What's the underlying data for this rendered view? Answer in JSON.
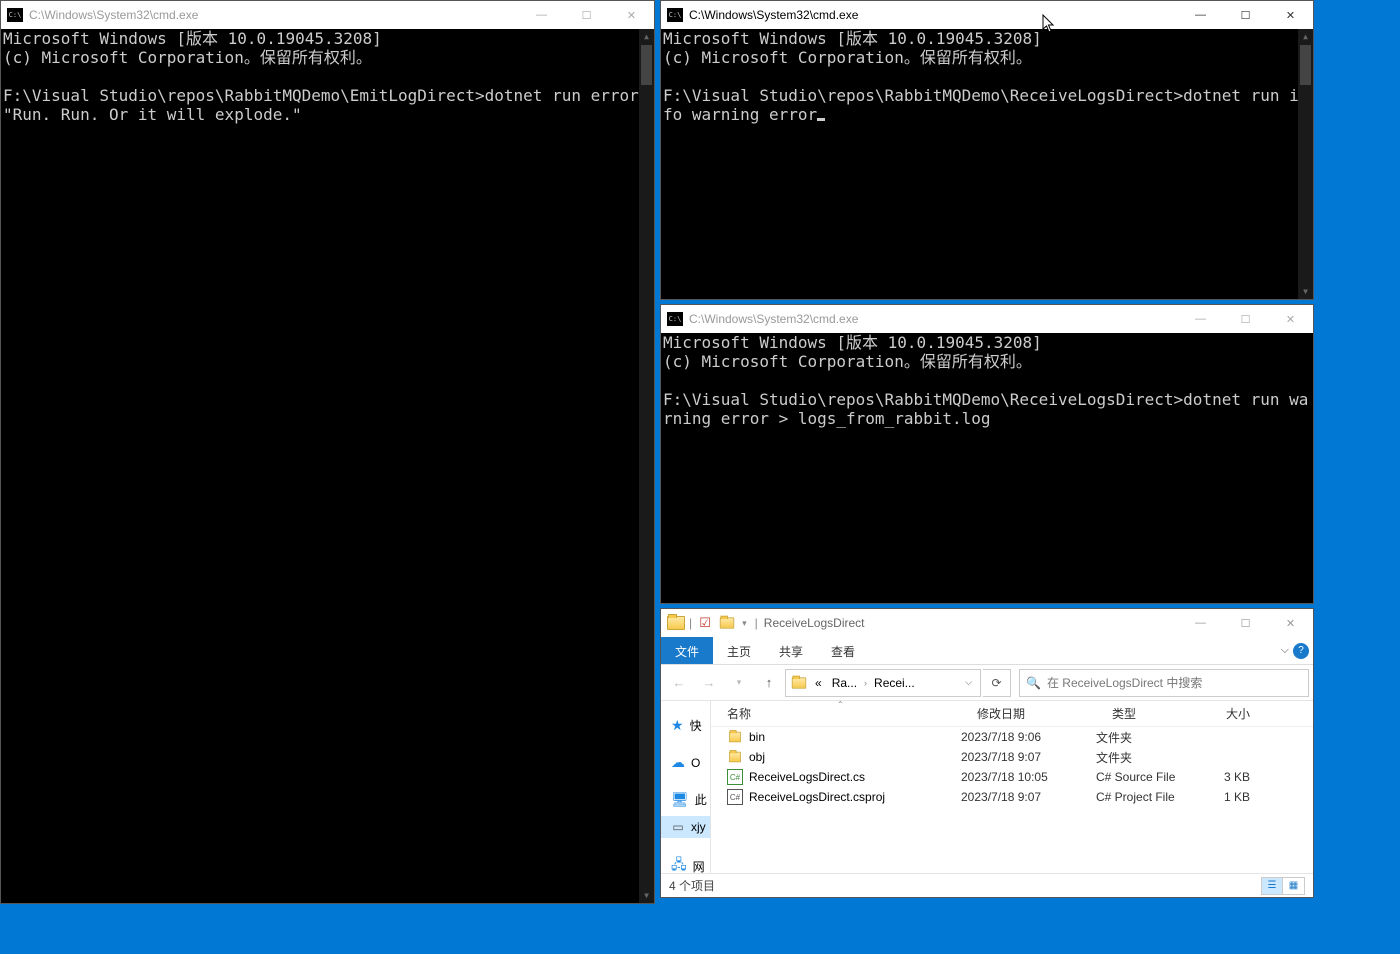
{
  "cmd_left": {
    "title": "C:\\Windows\\System32\\cmd.exe",
    "line1": "Microsoft Windows [版本 10.0.19045.3208]",
    "line2": "(c) Microsoft Corporation。保留所有权利。",
    "cmd": "F:\\Visual Studio\\repos\\RabbitMQDemo\\EmitLogDirect>dotnet run error \"Run. Run. Or it will explode.\""
  },
  "cmd_tr": {
    "title": "C:\\Windows\\System32\\cmd.exe",
    "line1": "Microsoft Windows [版本 10.0.19045.3208]",
    "line2": "(c) Microsoft Corporation。保留所有权利。",
    "cmd": "F:\\Visual Studio\\repos\\RabbitMQDemo\\ReceiveLogsDirect>dotnet run info warning error"
  },
  "cmd_mr": {
    "title": "C:\\Windows\\System32\\cmd.exe",
    "line1": "Microsoft Windows [版本 10.0.19045.3208]",
    "line2": "(c) Microsoft Corporation。保留所有权利。",
    "cmd": "F:\\Visual Studio\\repos\\RabbitMQDemo\\ReceiveLogsDirect>dotnet run warning error > logs_from_rabbit.log"
  },
  "explorer": {
    "title_folder": "ReceiveLogsDirect",
    "tabs": {
      "file": "文件",
      "home": "主页",
      "share": "共享",
      "view": "查看"
    },
    "breadcrumb": {
      "prefix": "«",
      "p1": "Ra...",
      "p2": "Recei..."
    },
    "search_placeholder": "在 ReceiveLogsDirect 中搜索",
    "columns": {
      "name": "名称",
      "date": "修改日期",
      "type": "类型",
      "size": "大小"
    },
    "navpane": {
      "quick": "快",
      "onedrive": "O",
      "thispc": "此",
      "xjy": "xjy",
      "network": "网"
    },
    "rows": [
      {
        "name": "bin",
        "date": "2023/7/18 9:06",
        "type": "文件夹",
        "size": "",
        "icon": "folder"
      },
      {
        "name": "obj",
        "date": "2023/7/18 9:07",
        "type": "文件夹",
        "size": "",
        "icon": "folder"
      },
      {
        "name": "ReceiveLogsDirect.cs",
        "date": "2023/7/18 10:05",
        "type": "C# Source File",
        "size": "3 KB",
        "icon": "cs"
      },
      {
        "name": "ReceiveLogsDirect.csproj",
        "date": "2023/7/18 9:07",
        "type": "C# Project File",
        "size": "1 KB",
        "icon": "csproj"
      }
    ],
    "status": "4 个项目"
  },
  "winbuttons": {
    "min": "—",
    "max": "☐",
    "close": "✕"
  }
}
